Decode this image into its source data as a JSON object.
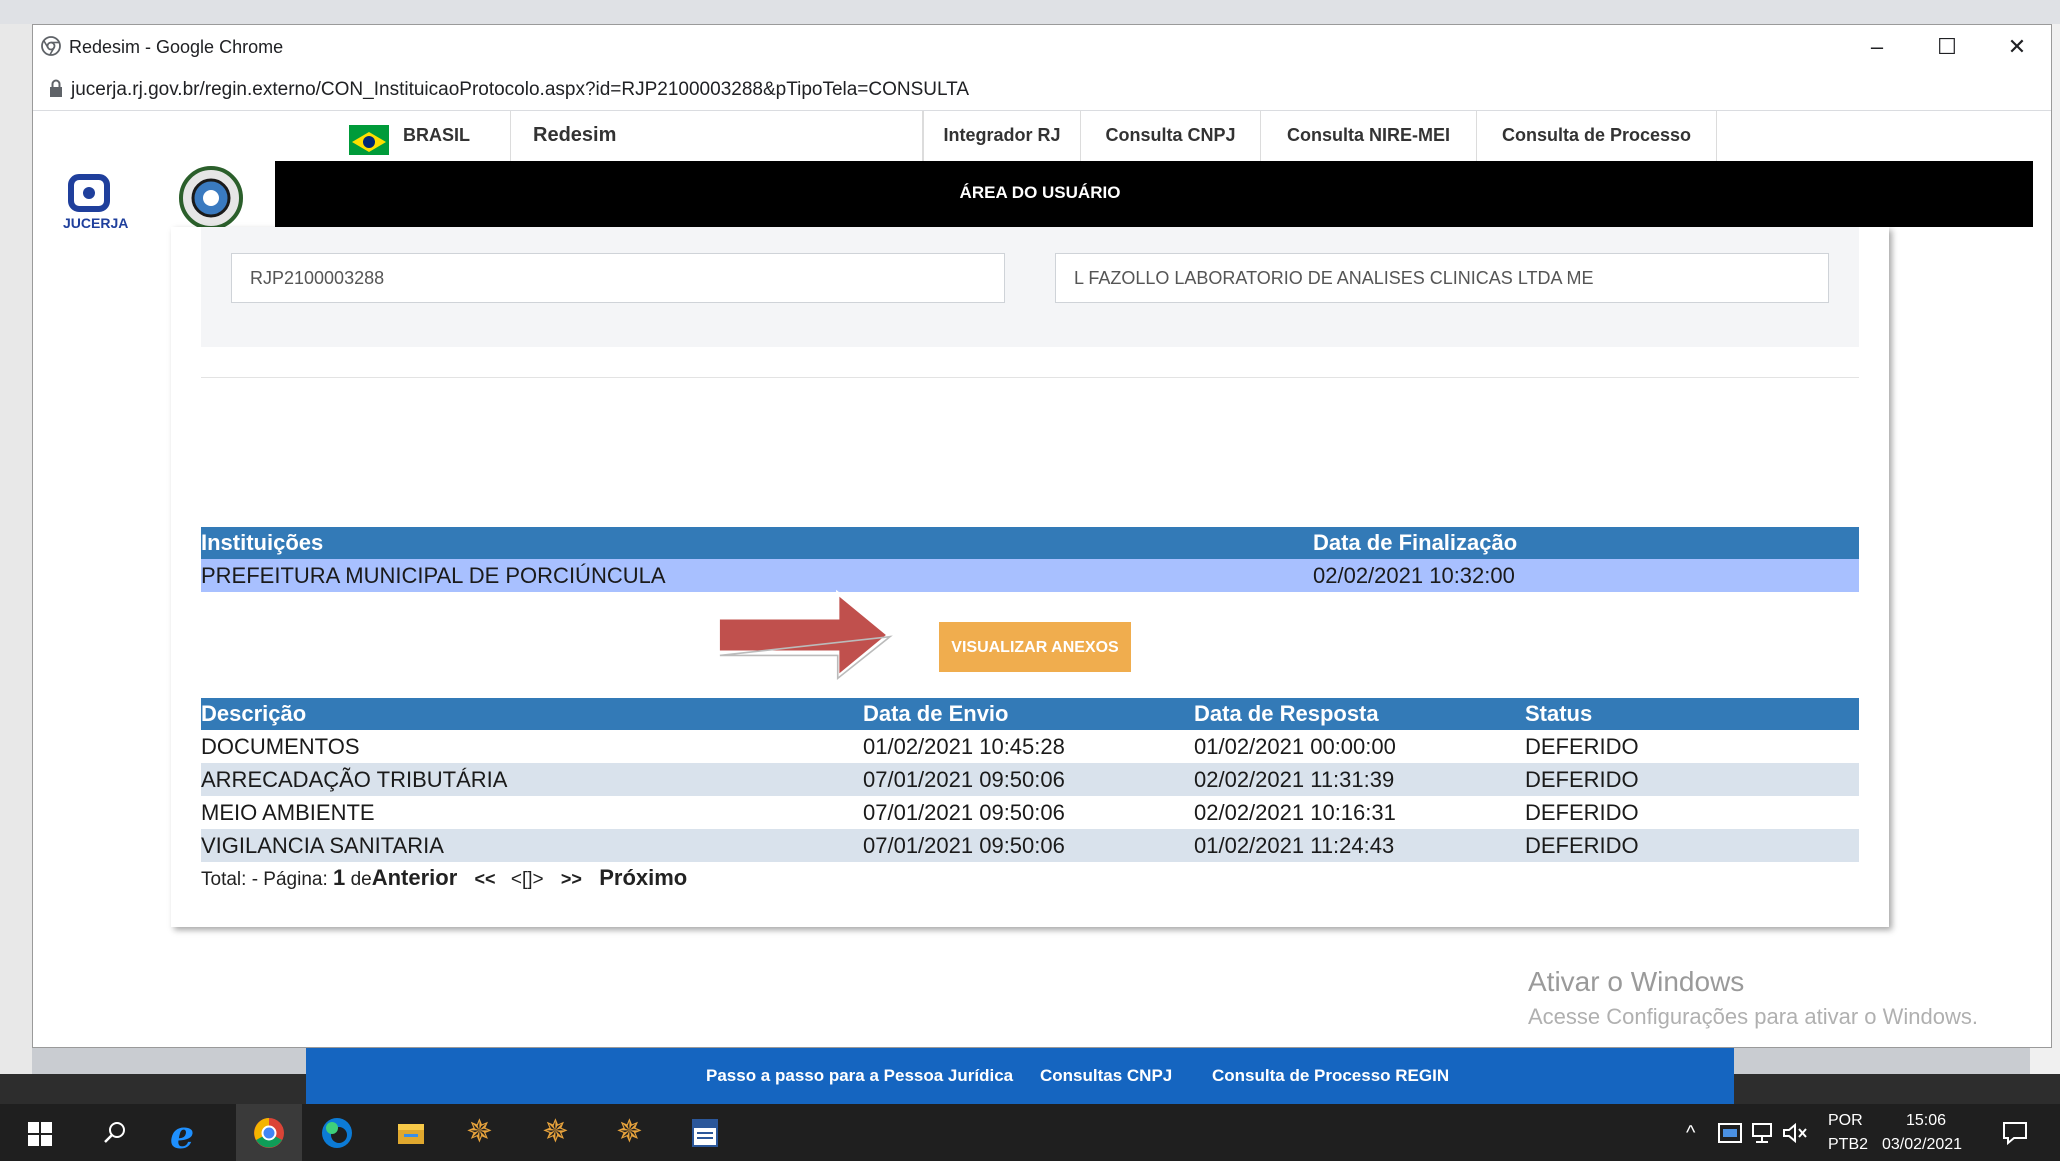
{
  "window": {
    "title": "Redesim - Google Chrome",
    "url": "jucerja.rj.gov.br/regin.externo/CON_InstituicaoProtocolo.aspx?id=RJP2100003288&pTipoTela=CONSULTA",
    "minimize": "–",
    "maximize": "☐",
    "close": "✕"
  },
  "nav": {
    "brasil": "BRASIL",
    "redesim": "Redesim",
    "items": [
      "Integrador RJ",
      "Consulta CNPJ",
      "Consulta NIRE-MEI",
      "Consulta de Processo"
    ],
    "area": "ÁREA DO USUÁRIO",
    "logo_text": "JUCERJA"
  },
  "form": {
    "protocol": "RJP2100003288",
    "company": "L FAZOLLO LABORATORIO DE ANALISES CLINICAS LTDA ME"
  },
  "institutions": {
    "headers": [
      "Instituições",
      "Data de Finalização"
    ],
    "rows": [
      [
        "PREFEITURA MUNICIPAL DE PORCIÚNCULA",
        "02/02/2021 10:32:00"
      ]
    ]
  },
  "button": {
    "anexos": "VISUALIZAR ANEXOS"
  },
  "details": {
    "headers": [
      "Descrição",
      "Data de Envio",
      "Data de Resposta",
      "Status"
    ],
    "rows": [
      [
        "DOCUMENTOS",
        "01/02/2021 10:45:28",
        "01/02/2021 00:00:00",
        "DEFERIDO"
      ],
      [
        "ARRECADAÇÃO TRIBUTÁRIA",
        "07/01/2021 09:50:06",
        "02/02/2021 11:31:39",
        "DEFERIDO"
      ],
      [
        "MEIO AMBIENTE",
        "07/01/2021 09:50:06",
        "02/02/2021 10:16:31",
        "DEFERIDO"
      ],
      [
        "VIGILANCIA SANITARIA",
        "07/01/2021 09:50:06",
        "01/02/2021 11:24:43",
        "DEFERIDO"
      ]
    ]
  },
  "pager": {
    "total": "Total: - Página:",
    "page": "1",
    "de": "de",
    "anterior": "Anterior",
    "first": "<<",
    "current": "<[]>",
    "last": ">>",
    "proximo": "Próximo"
  },
  "watermark": {
    "line1": "Ativar o Windows",
    "line2": "Acesse Configurações para ativar o Windows."
  },
  "footer": {
    "links": [
      "Passo a passo para a Pessoa Jurídica",
      "Consultas CNPJ",
      "Consulta de Processo REGIN"
    ]
  },
  "taskbar": {
    "lang1": "POR",
    "lang2": "PTB2",
    "time": "15:06",
    "date": "03/02/2021",
    "tray_up": "^"
  },
  "colors": {
    "header_blue": "#337ab7",
    "row_highlight": "#a8c0ff",
    "row_alt": "#d9e2ec",
    "button_orange": "#f0ad4e",
    "arrow_red": "#c0504d",
    "footer_blue": "#1565c0"
  }
}
